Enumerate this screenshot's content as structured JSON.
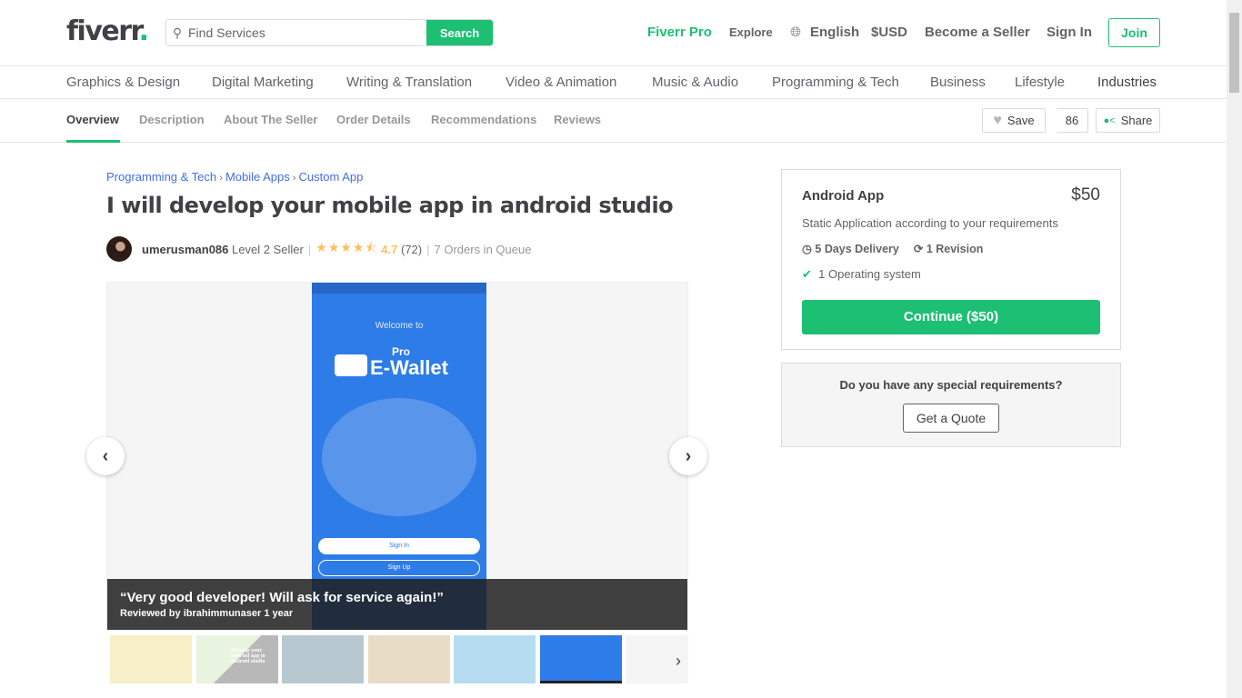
{
  "header": {
    "logo": "fiverr",
    "search_placeholder": "Find Services",
    "search_button": "Search",
    "nav": {
      "pro": "Fiverr Pro",
      "explore": "Explore",
      "language": "English",
      "currency": "$USD",
      "become_seller": "Become a Seller",
      "sign_in": "Sign In",
      "join": "Join"
    }
  },
  "categories": [
    "Graphics & Design",
    "Digital Marketing",
    "Writing & Translation",
    "Video & Animation",
    "Music & Audio",
    "Programming & Tech",
    "Business",
    "Lifestyle",
    "Industries"
  ],
  "subnav": {
    "tabs": [
      "Overview",
      "Description",
      "About The Seller",
      "Order Details",
      "Recommendations",
      "Reviews"
    ],
    "active": "Overview",
    "save": "Save",
    "save_count": "86",
    "share": "Share"
  },
  "breadcrumb": [
    "Programming & Tech",
    "Mobile Apps",
    "Custom App"
  ],
  "gig": {
    "title": "I will develop your mobile app in android studio",
    "seller": "umerusman086",
    "level": "Level 2 Seller",
    "rating": "4.7",
    "rating_value": 4.7,
    "reviews_count": "(72)",
    "queue": "7 Orders in Queue"
  },
  "gallery": {
    "image_text": {
      "welcome": "Welcome to",
      "pro": "Pro",
      "brand": "E-Wallet",
      "sign_in": "Sign In",
      "sign_up": "Sign Up"
    },
    "review_quote": "“Very good developer! Will ask for service again!”",
    "review_by": "Reviewed by ibrahimmunaser 1 year",
    "thumb_caption": "Develop your android app in android studio"
  },
  "package": {
    "name": "Android App",
    "price": "$50",
    "description": "Static Application according to your requirements",
    "delivery": "5 Days Delivery",
    "revisions": "1 Revision",
    "features": [
      "1 Operating system"
    ],
    "cta": "Continue ($50)"
  },
  "quote": {
    "question": "Do you have any special requirements?",
    "button": "Get a Quote"
  },
  "colors": {
    "brand": "#1dbf73",
    "link": "#446ee7",
    "star": "#ffbe5b"
  }
}
